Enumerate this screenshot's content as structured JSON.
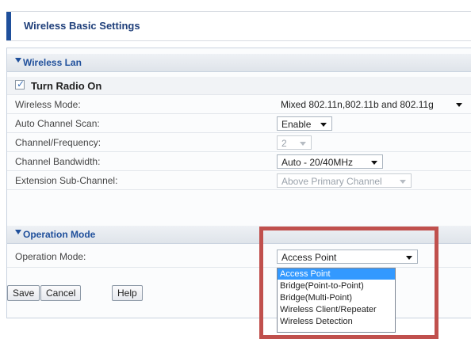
{
  "page": {
    "title": "Wireless Basic Settings"
  },
  "wireless_lan": {
    "section_title": "Wireless Lan",
    "turn_radio_on": {
      "label": "Turn Radio On",
      "checked": true
    },
    "fields": [
      {
        "label": "Wireless Mode:",
        "value": "Mixed 802.11n,802.11b and 802.11g",
        "disabled": false
      },
      {
        "label": "Auto Channel Scan:",
        "value": "Enable",
        "disabled": false
      },
      {
        "label": "Channel/Frequency:",
        "value": "2",
        "disabled": true
      },
      {
        "label": "Channel Bandwidth:",
        "value": "Auto - 20/40MHz",
        "disabled": false
      },
      {
        "label": "Extension Sub-Channel:",
        "value": "Above Primary Channel",
        "disabled": true
      }
    ]
  },
  "operation_mode": {
    "section_title": "Operation Mode",
    "label": "Operation Mode:",
    "value": "Access Point",
    "options": [
      "Access Point",
      "Bridge(Point-to-Point)",
      "Bridge(Multi-Point)",
      "Wireless Client/Repeater",
      "Wireless Detection"
    ],
    "highlighted_option": "Access Point"
  },
  "buttons": {
    "save": "Save",
    "cancel": "Cancel",
    "help": "Help"
  },
  "colors": {
    "accent": "#1f4f9b",
    "annotation_box": "#c0504d",
    "selection": "#3399ff"
  },
  "icons": {
    "section_toggle": "triangle-down-icon",
    "select_arrow": "chevron-down-icon"
  }
}
